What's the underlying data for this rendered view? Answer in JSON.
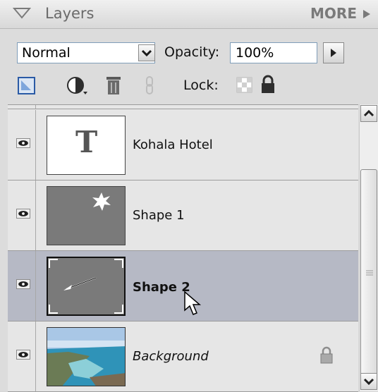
{
  "header": {
    "title": "Layers",
    "more_label": "MORE"
  },
  "options": {
    "blend_mode": "Normal",
    "opacity_label": "Opacity:",
    "opacity_value": "100%",
    "lock_label": "Lock:"
  },
  "toolbar_icons": [
    "new-layer-icon",
    "adjustment-layer-icon",
    "trash-icon",
    "link-icon"
  ],
  "layers": [
    {
      "name": "Kohala Hotel",
      "type": "text",
      "thumb_text": "T",
      "visible": true,
      "selected": false,
      "locked": false
    },
    {
      "name": "Shape 1",
      "type": "shape",
      "visible": true,
      "selected": false,
      "locked": false
    },
    {
      "name": "Shape 2",
      "type": "shape",
      "visible": true,
      "selected": true,
      "locked": false
    },
    {
      "name": "Background",
      "type": "image",
      "visible": true,
      "selected": false,
      "locked": true
    }
  ],
  "colors": {
    "selected_row": "#b6b9c5",
    "shape_fill": "#7a7a7a",
    "panel_bg": "#dcdcdc"
  }
}
